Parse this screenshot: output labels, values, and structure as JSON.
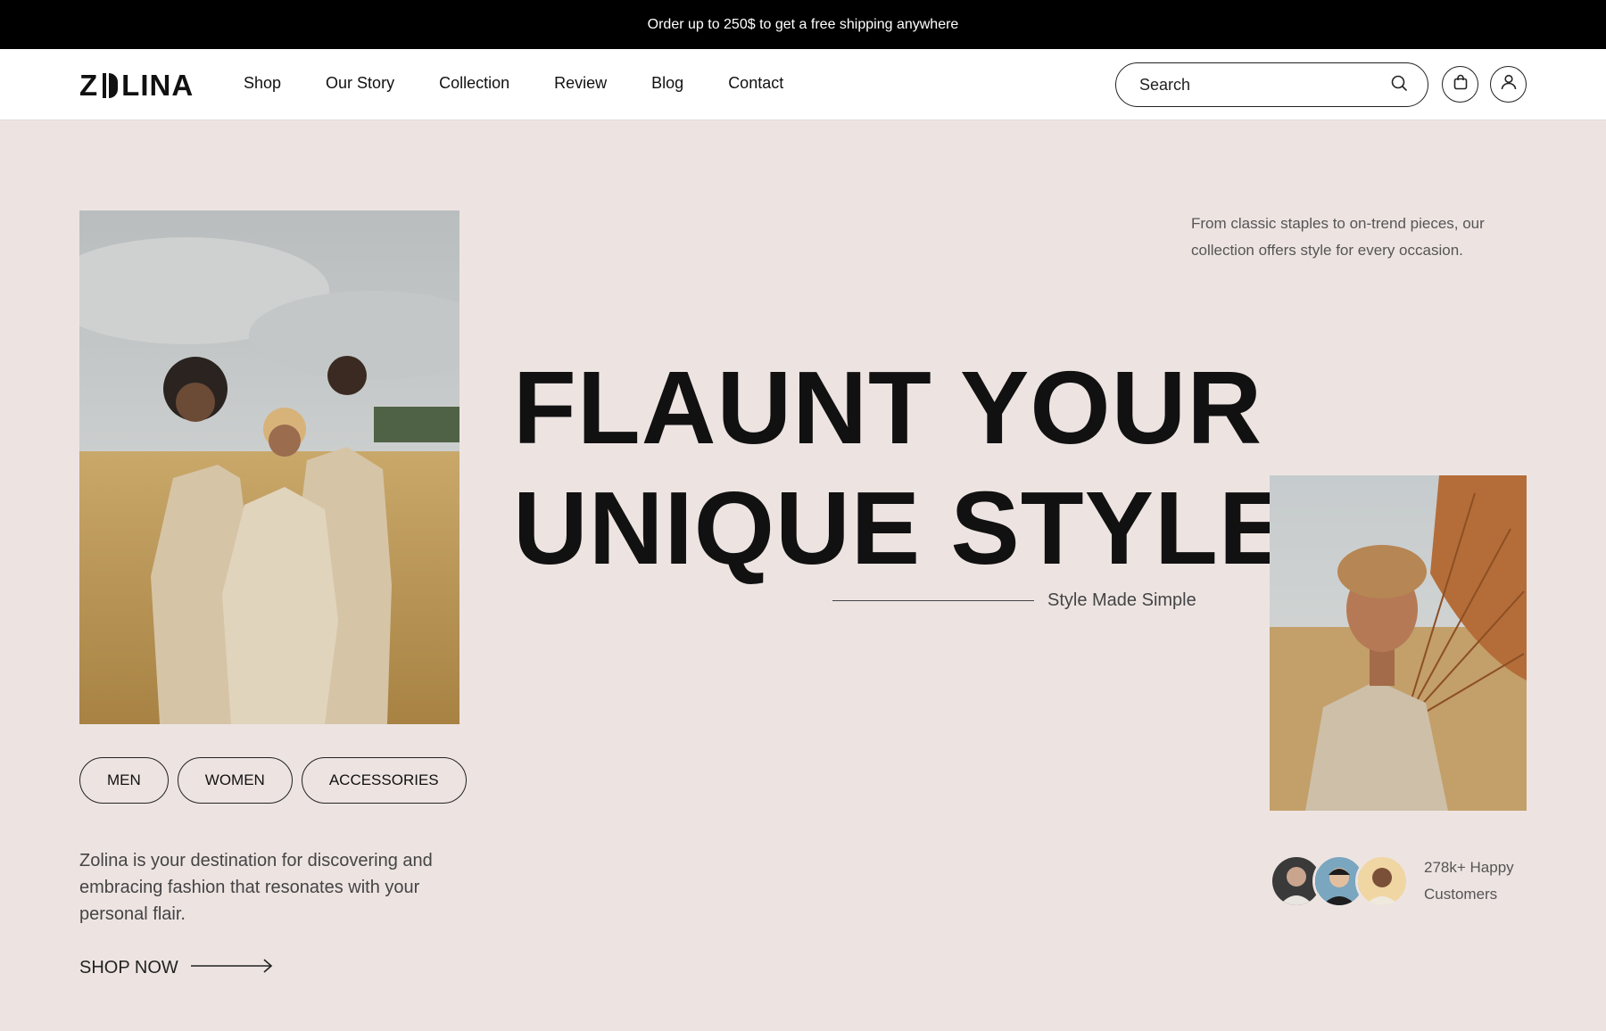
{
  "announcement": "Order up to 250$ to get a free shipping anywhere",
  "brand": {
    "before": "Z",
    "after": "LINA"
  },
  "nav": [
    "Shop",
    "Our Story",
    "Collection",
    "Review",
    "Blog",
    "Contact"
  ],
  "search": {
    "placeholder": "Search"
  },
  "hero": {
    "headline_line1": "FLAUNT YOUR",
    "headline_line2": "UNIQUE STYLE",
    "tagline": "Style Made Simple",
    "blurb": "From classic staples to on-trend pieces, our collection offers style for every occasion.",
    "description": "Zolina is your destination for discovering and embracing fashion that resonates with your personal flair.",
    "cta": "SHOP NOW"
  },
  "categories": [
    "MEN",
    "WOMEN",
    "ACCESSORIES"
  ],
  "social_proof": {
    "line1": "278k+ Happy",
    "line2": "Customers"
  },
  "colors": {
    "background": "#ede4e2",
    "topbar": "#000000",
    "text": "#111111"
  }
}
